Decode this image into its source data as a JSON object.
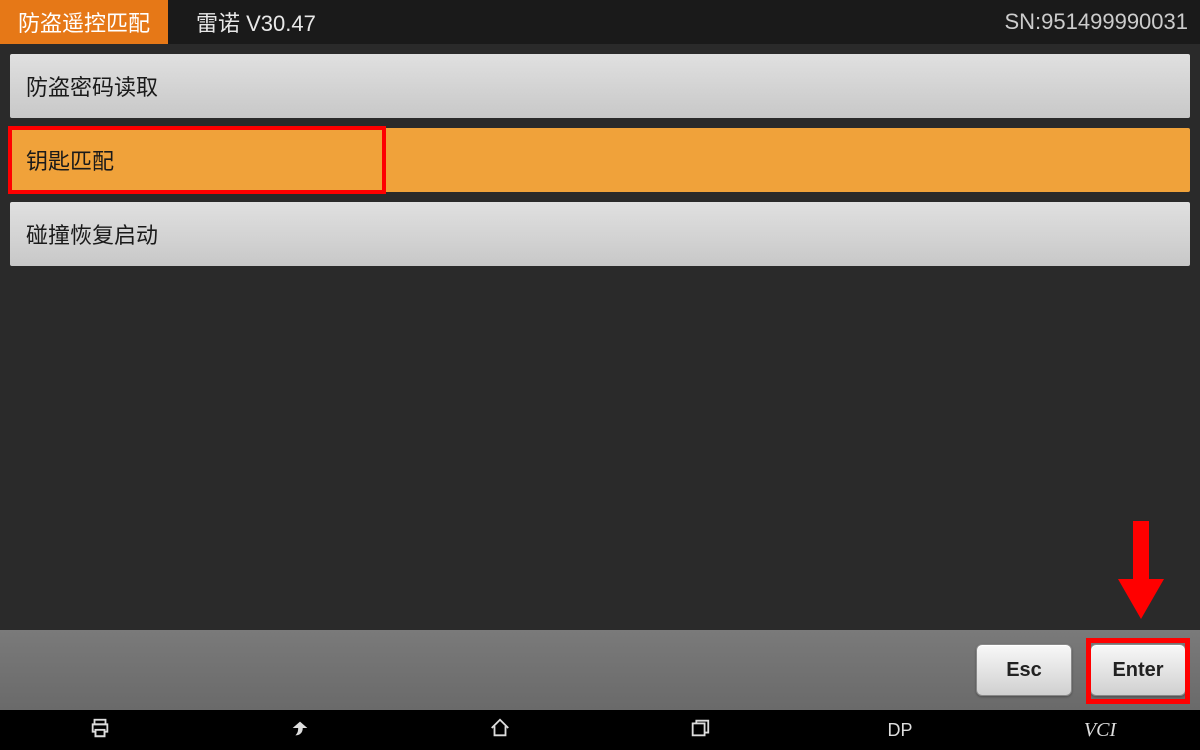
{
  "header": {
    "tag": "防盗遥控匹配",
    "title": "雷诺  V30.47",
    "sn_label": "SN:951499990031"
  },
  "menu": {
    "items": [
      {
        "label": "防盗密码读取",
        "selected": false
      },
      {
        "label": "钥匙匹配",
        "selected": true
      },
      {
        "label": "碰撞恢复启动",
        "selected": false
      }
    ]
  },
  "footer": {
    "esc_label": "Esc",
    "enter_label": "Enter"
  },
  "nav": {
    "dp_label": "DP",
    "vci_label": "VCI"
  },
  "annotations": {
    "highlight_selected_item": 1,
    "highlight_enter_button": true,
    "arrow_to_enter": true,
    "highlight_color": "#ff0000"
  }
}
